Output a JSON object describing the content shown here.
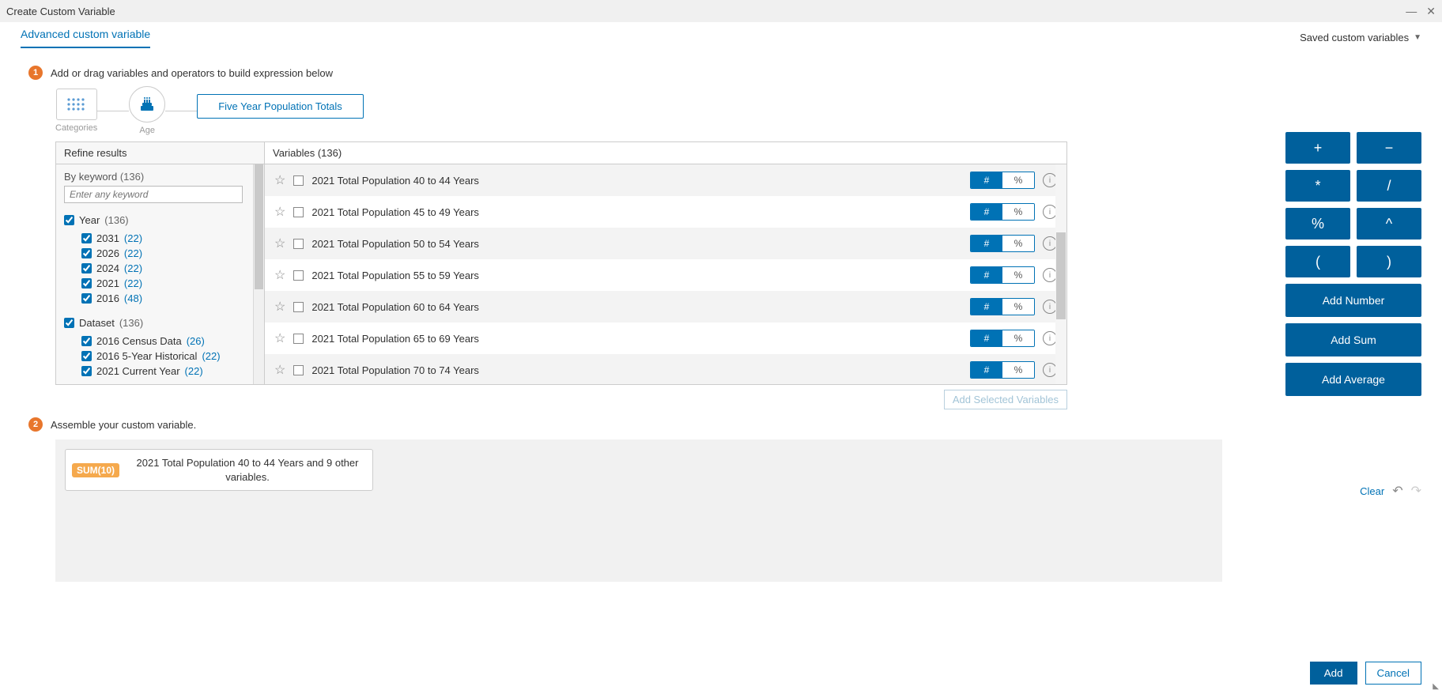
{
  "window": {
    "title": "Create Custom Variable"
  },
  "header": {
    "tab": "Advanced custom variable",
    "saved": "Saved custom variables"
  },
  "step1": {
    "badge": "1",
    "text": "Add or drag variables and operators to build expression below"
  },
  "breadcrumb": {
    "categories": "Categories",
    "age": "Age",
    "current": "Five Year Population Totals"
  },
  "refine": {
    "header": "Refine results",
    "keyword_label": "By keyword",
    "keyword_count": "(136)",
    "keyword_placeholder": "Enter any keyword",
    "year": {
      "label": "Year",
      "count": "(136)",
      "items": [
        {
          "label": "2031",
          "count": "(22)"
        },
        {
          "label": "2026",
          "count": "(22)"
        },
        {
          "label": "2024",
          "count": "(22)"
        },
        {
          "label": "2021",
          "count": "(22)"
        },
        {
          "label": "2016",
          "count": "(48)"
        }
      ]
    },
    "dataset": {
      "label": "Dataset",
      "count": "(136)",
      "items": [
        {
          "label": "2016 Census Data",
          "count": "(26)"
        },
        {
          "label": "2016 5-Year Historical",
          "count": "(22)"
        },
        {
          "label": "2021 Current Year",
          "count": "(22)"
        }
      ]
    }
  },
  "vars": {
    "header": "Variables (136)",
    "rows": [
      {
        "name": "2021 Total Population 40 to 44 Years"
      },
      {
        "name": "2021 Total Population 45 to 49 Years"
      },
      {
        "name": "2021 Total Population 50 to 54 Years"
      },
      {
        "name": "2021 Total Population 55 to 59 Years"
      },
      {
        "name": "2021 Total Population 60 to 64 Years"
      },
      {
        "name": "2021 Total Population 65 to 69 Years"
      },
      {
        "name": "2021 Total Population 70 to 74 Years"
      }
    ],
    "unit_num": "#",
    "unit_pct": "%"
  },
  "add_selected": "Add Selected Variables",
  "step2": {
    "badge": "2",
    "text": "Assemble your custom variable.",
    "clear": "Clear",
    "sum_badge": "SUM(10)",
    "expr": "2021 Total Population 40 to 44 Years and 9 other variables."
  },
  "ops": {
    "plus": "+",
    "minus": "−",
    "times": "*",
    "div": "/",
    "pct": "%",
    "caret": "^",
    "lpar": "(",
    "rpar": ")",
    "add_number": "Add Number",
    "add_sum": "Add Sum",
    "add_average": "Add Average"
  },
  "bottom": {
    "add": "Add",
    "cancel": "Cancel"
  }
}
